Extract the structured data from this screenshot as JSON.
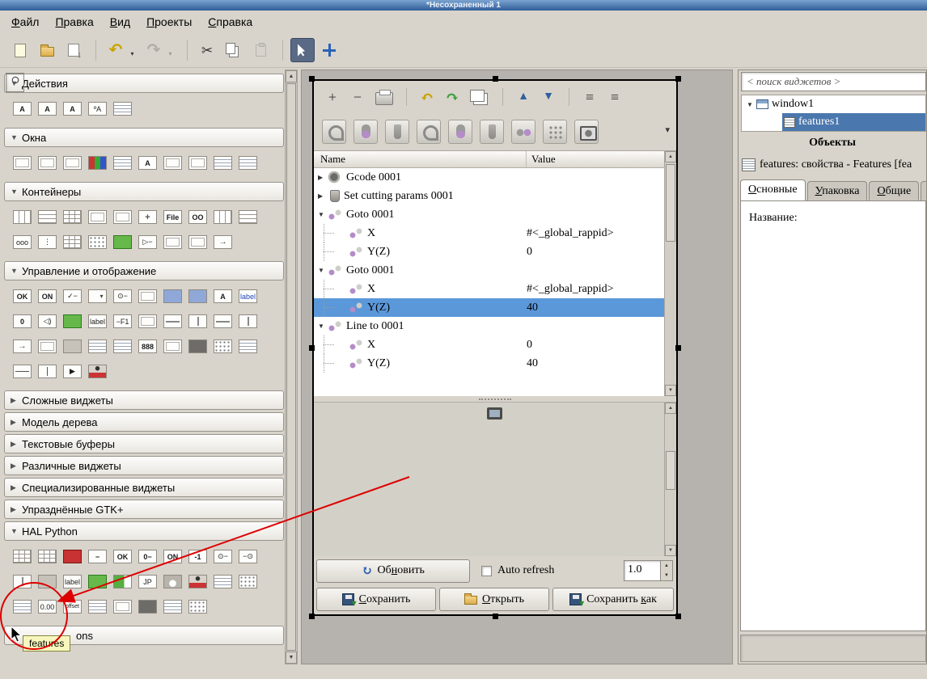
{
  "window": {
    "title": "*Несохраненный 1"
  },
  "menubar": {
    "items": [
      "Файл",
      "Правка",
      "Вид",
      "Проекты",
      "Справка"
    ]
  },
  "icons": {
    "section_open": "▼",
    "section_closed": "▶",
    "scroll_up": "▲",
    "scroll_down": "▼",
    "spin_up": "▲",
    "spin_down": "▼",
    "refresh": "↻",
    "overflow_chevron": "▾"
  },
  "toolbar": {
    "buttons": [
      {
        "n": "new-document-icon",
        "c": "i-new"
      },
      {
        "n": "open-document-icon",
        "c": "i-open"
      },
      {
        "n": "save-document-icon",
        "c": "i-save"
      },
      {
        "c": "sepv"
      },
      {
        "n": "undo-icon",
        "g": "↶",
        "c": "g-undo"
      },
      {
        "n": "undo-dropdown-chevron-icon",
        "g": "▾",
        "c": "chev"
      },
      {
        "n": "redo-icon",
        "g": "↷",
        "c": "g-redo disabled"
      },
      {
        "n": "redo-dropdown-chevron-icon",
        "g": "▾",
        "c": "chev disabled"
      },
      {
        "c": "sepv"
      },
      {
        "n": "cut-icon",
        "g": "✂",
        "c": "g-cut"
      },
      {
        "n": "copy-icon",
        "c": "i-copy"
      },
      {
        "n": "paste-icon",
        "c": "i-paste disabled"
      },
      {
        "c": "sepv"
      },
      {
        "n": "select-pointer-icon",
        "c": "i-pointer pressed"
      },
      {
        "n": "drag-move-icon",
        "c": "i-move"
      }
    ]
  },
  "palette": {
    "partial_section_label": "ons",
    "sections": [
      {
        "id": "actions",
        "label": "Действия",
        "state": "expanded",
        "icons": [
          {
            "n": "action-icon",
            "t": "A",
            "c": "txt"
          },
          {
            "n": "toggle-action-icon",
            "t": "A",
            "c": "txt"
          },
          {
            "n": "radio-action-icon",
            "t": "A",
            "c": "txt"
          },
          {
            "n": "recent-action-icon",
            "t": "ºA",
            "c": "txt plain"
          },
          {
            "n": "action-group-icon",
            "c": "lines"
          }
        ]
      },
      {
        "id": "windows",
        "label": "Окна",
        "state": "expanded",
        "icons": [
          {
            "n": "window-icon",
            "c": "frame"
          },
          {
            "n": "offscreen-window-icon",
            "c": "frame"
          },
          {
            "n": "application-window-icon",
            "c": "frame"
          },
          {
            "n": "color-selection-icon",
            "c": "rgb"
          },
          {
            "n": "list-window-icon",
            "c": "lines"
          },
          {
            "n": "about-dialog-icon",
            "t": "A",
            "c": "txt"
          },
          {
            "n": "dialog-icon",
            "c": "frame"
          },
          {
            "n": "message-dialog-icon",
            "c": "frame"
          },
          {
            "n": "assistant-icon",
            "c": "lines"
          },
          {
            "n": "menu-window-icon",
            "c": "lines"
          }
        ]
      },
      {
        "id": "containers",
        "label": "Контейнеры",
        "state": "expanded",
        "icons": [
          {
            "n": "hbox-icon",
            "c": "cols"
          },
          {
            "n": "vbox-icon",
            "c": "rows"
          },
          {
            "n": "grid-icon",
            "c": "gridp"
          },
          {
            "n": "notebook-icon",
            "c": "frame"
          },
          {
            "n": "frame-icon",
            "c": "frame"
          },
          {
            "n": "alignment-icon",
            "c": "plus"
          },
          {
            "n": "file-chooser-widget-icon",
            "t": "File",
            "c": "txt"
          },
          {
            "n": "paned-icon",
            "t": "OO",
            "c": "txt"
          },
          {
            "n": "vpaned-icon",
            "c": "cols"
          },
          {
            "n": "hpaned-icon",
            "c": "rows"
          },
          {
            "n": "hbutton-box-icon",
            "t": "ooo",
            "c": "txt plain"
          },
          {
            "n": "vbutton-box-icon",
            "t": "⋮",
            "c": "txt plain"
          },
          {
            "n": "layout-icon",
            "c": "gridp"
          },
          {
            "n": "table-icon",
            "c": "dots"
          },
          {
            "n": "notebook-green-icon",
            "c": "green"
          },
          {
            "n": "expander-widget-icon",
            "t": "▷−",
            "c": "txt plain"
          },
          {
            "n": "scrolled-window-icon",
            "c": "frame"
          },
          {
            "n": "viewport-icon",
            "c": "frame"
          },
          {
            "n": "toolbar-widget-icon",
            "c": "arrowbox"
          }
        ]
      },
      {
        "id": "control-display",
        "label": "Управление и отображение",
        "state": "expanded",
        "icons": [
          {
            "n": "button-icon",
            "t": "OK",
            "c": "txt"
          },
          {
            "n": "toggle-button-icon",
            "t": "ON",
            "c": "txt"
          },
          {
            "n": "check-button-icon",
            "t": "✓−",
            "c": "txt plain"
          },
          {
            "n": "combo-box-icon",
            "c": "combo"
          },
          {
            "n": "radio-button-icon",
            "t": "⊙−",
            "c": "txt plain"
          },
          {
            "n": "entry-icon",
            "c": "frame"
          },
          {
            "n": "image-icon",
            "c": "blue"
          },
          {
            "n": "image-frame-icon",
            "c": "blue"
          },
          {
            "n": "font-button-icon",
            "t": "A",
            "c": "txt"
          },
          {
            "n": "label-widget-icon",
            "t": "label",
            "c": "txt plain bluetext"
          },
          {
            "n": "spin-button-icon",
            "t": "0",
            "c": "txt"
          },
          {
            "n": "volume-button-icon",
            "t": "◁)",
            "c": "txt plain"
          },
          {
            "n": "link-button-icon",
            "c": "green"
          },
          {
            "n": "label2-widget-icon",
            "t": "label",
            "c": "txt plain"
          },
          {
            "n": "accel-label-icon",
            "t": "−F1",
            "c": "txt plain"
          },
          {
            "n": "entry2-icon",
            "c": "frame"
          },
          {
            "n": "hscale-icon",
            "c": "hslider"
          },
          {
            "n": "vscale-icon",
            "c": "vslider"
          },
          {
            "n": "hscrollbar-icon",
            "c": "hslider"
          },
          {
            "n": "vscrollbar-icon",
            "c": "vslider"
          },
          {
            "n": "arrow-widget-icon",
            "c": "arrowbox"
          },
          {
            "n": "separator-frame-icon",
            "c": "frame"
          },
          {
            "n": "statusbar-icon",
            "c": "gray"
          },
          {
            "n": "text-view-icon",
            "c": "lines"
          },
          {
            "n": "text-view2-icon",
            "c": "lines"
          },
          {
            "n": "calendar-icon",
            "t": "888",
            "c": "txt"
          },
          {
            "n": "progress-bar-icon",
            "c": "frame"
          },
          {
            "n": "level-bar-icon",
            "c": "dark"
          },
          {
            "n": "drawing-area-icon",
            "c": "dots"
          },
          {
            "n": "tree-view-icon",
            "c": "lines"
          },
          {
            "n": "hseparator-icon",
            "c": "hline"
          },
          {
            "n": "vseparator-icon",
            "c": "vline"
          },
          {
            "n": "media-play-icon",
            "t": "▶",
            "c": "txt plain"
          },
          {
            "n": "animation-icon",
            "c": "person"
          }
        ]
      },
      {
        "id": "complex-widgets",
        "label": "Сложные виджеты",
        "state": "collapsed",
        "icons": []
      },
      {
        "id": "tree-model",
        "label": "Модель дерева",
        "state": "collapsed",
        "icons": []
      },
      {
        "id": "text-buffers",
        "label": "Текстовые буферы",
        "state": "collapsed",
        "icons": []
      },
      {
        "id": "misc-widgets",
        "label": "Различные виджеты",
        "state": "collapsed",
        "icons": []
      },
      {
        "id": "special-widgets",
        "label": "Специализированные виджеты",
        "state": "collapsed",
        "icons": []
      },
      {
        "id": "deprecated-gtk",
        "label": "Упразднённые GTK+",
        "state": "collapsed",
        "icons": []
      },
      {
        "id": "hal-python",
        "label": "HAL Python",
        "state": "expanded",
        "icons": [
          {
            "n": "hal-table-icon",
            "c": "gridp"
          },
          {
            "n": "hal-hbox-icon",
            "c": "gridp"
          },
          {
            "n": "hal-led-icon",
            "c": "red"
          },
          {
            "n": "hal-checkbutton-icon",
            "t": "−",
            "c": "txt"
          },
          {
            "n": "hal-button-icon",
            "t": "OK",
            "c": "txt"
          },
          {
            "n": "hal-spinbutton-icon",
            "t": "0−",
            "c": "txt"
          },
          {
            "n": "hal-togglebutton-icon",
            "t": "ON",
            "c": "txt"
          },
          {
            "n": "hal-spinbox-icon",
            "t": "-1",
            "c": "txt"
          },
          {
            "n": "hal-radiobutton-icon",
            "t": "⊙−",
            "c": "txt plain"
          },
          {
            "n": "hal-radiobutton2-icon",
            "t": "−⊙",
            "c": "txt plain"
          },
          {
            "n": "hal-jog-wheel-icon",
            "c": "vslider"
          },
          {
            "n": "hal-statusbar-icon",
            "c": "gray"
          },
          {
            "n": "hal-label-icon",
            "t": "label",
            "c": "txt plain"
          },
          {
            "n": "hal-image-icon",
            "c": "green"
          },
          {
            "n": "hal-bar-icon",
            "c": "greenbar"
          },
          {
            "n": "hal-jp-icon",
            "t": "JP",
            "c": "txt plain"
          },
          {
            "n": "hal-meter-icon",
            "c": "meter"
          },
          {
            "n": "hal-animation-icon",
            "c": "person"
          },
          {
            "n": "hal-list-icon",
            "c": "lines"
          },
          {
            "n": "hal-iconview-icon",
            "c": "dots"
          },
          {
            "n": "features-widget-icon",
            "c": "lines"
          },
          {
            "n": "hal-number-icon",
            "t": "0.00",
            "c": "txt plain"
          },
          {
            "n": "hal-offset-icon",
            "t": "offset",
            "c": "txt plain tiny"
          },
          {
            "n": "hal-tree-icon",
            "c": "lines"
          },
          {
            "n": "hal-filechooser-icon",
            "c": "search"
          },
          {
            "n": "hal-frame-icon",
            "c": "frame"
          },
          {
            "n": "hal-dro-icon",
            "c": "dark"
          },
          {
            "n": "hal-textview-icon",
            "c": "lines"
          },
          {
            "n": "hal-gridview-icon",
            "c": "dots"
          }
        ]
      }
    ]
  },
  "canvas": {
    "toolbar_primary": [
      {
        "n": "add-icon",
        "g": "+",
        "c": "big"
      },
      {
        "n": "remove-icon",
        "g": "−",
        "c": "big"
      },
      {
        "n": "print-icon",
        "c": "printer"
      },
      {
        "c": "tsep"
      },
      {
        "n": "undo-icon",
        "g": "↶",
        "c": "yellow"
      },
      {
        "n": "redo-icon",
        "g": "↷",
        "c": "greeng"
      },
      {
        "n": "duplicate-icon",
        "c": "copyi"
      },
      {
        "c": "tsep"
      },
      {
        "n": "move-up-icon",
        "g": "▲",
        "c": "blueg"
      },
      {
        "n": "move-down-icon",
        "g": "▼",
        "c": "blueg"
      },
      {
        "c": "tsep"
      },
      {
        "n": "indent-icon",
        "g": "≡",
        "c": "big"
      },
      {
        "n": "unindent-icon",
        "g": "≡",
        "c": "big"
      }
    ],
    "toolbar_tools": [
      {
        "n": "tool-profile-icon",
        "c": "t2 a"
      },
      {
        "n": "tool-ball-icon",
        "c": "t2 b"
      },
      {
        "n": "tool-mill-icon",
        "c": "t2 c"
      },
      {
        "n": "tool-profile2-icon",
        "c": "t2 a"
      },
      {
        "n": "tool-ball2-icon",
        "c": "t2 b"
      },
      {
        "n": "tool-mill2-icon",
        "c": "t2 c"
      },
      {
        "n": "tool-pair-icon",
        "c": "t2 d"
      },
      {
        "n": "tool-dot-grid-icon",
        "c": "t2 e"
      },
      {
        "n": "tool-camera-icon",
        "c": "t2 f"
      }
    ],
    "tree": {
      "columns": [
        "Name",
        "Value"
      ],
      "rows": [
        {
          "exp": "▶",
          "ic": "gear",
          "label": "Gcode 0001",
          "value": ""
        },
        {
          "exp": "▶",
          "ic": "tool",
          "label": "Set cutting params 0001",
          "value": ""
        },
        {
          "exp": "▼",
          "ic": "node",
          "label": "Goto 0001",
          "value": ""
        },
        {
          "indent": 1,
          "ic": "node",
          "label": "X",
          "value": "#<_global_rappid>"
        },
        {
          "indent": 1,
          "ic": "node",
          "label": "Y(Z)",
          "value": "0"
        },
        {
          "exp": "▼",
          "ic": "node",
          "label": "Goto 0001",
          "value": ""
        },
        {
          "indent": 1,
          "ic": "node",
          "label": "X",
          "value": "#<_global_rappid>"
        },
        {
          "indent": 1,
          "ic": "node",
          "label": "Y(Z)",
          "value": "40",
          "selected": true
        },
        {
          "exp": "▼",
          "ic": "node",
          "label": "Line to 0001",
          "value": ""
        },
        {
          "indent": 1,
          "ic": "node",
          "label": "X",
          "value": "0"
        },
        {
          "indent": 1,
          "ic": "node",
          "label": "Y(Z)",
          "value": "40"
        }
      ]
    },
    "refresh_button": {
      "label": "Обновить",
      "mn": 2
    },
    "auto_refresh_label": "Auto refresh",
    "interval_value": "1.0",
    "save_button": {
      "label": "Сохранить",
      "mn": 0
    },
    "open_button": {
      "label": "Открыть",
      "mn": 0
    },
    "save_as_button": {
      "label": "Сохранить как",
      "mn": 10
    }
  },
  "inspector": {
    "search_text": "< поиск виджетов >",
    "tree": {
      "root_label": "window1",
      "child_label": "features1"
    },
    "objects_header": "Объекты",
    "properties_title": "features: свойства - Features [fea",
    "tabs": [
      "Основные",
      "Упаковка",
      "Общие",
      "С"
    ],
    "name_property_label": "Название:"
  },
  "annotation": {
    "tooltip_text": "features"
  }
}
